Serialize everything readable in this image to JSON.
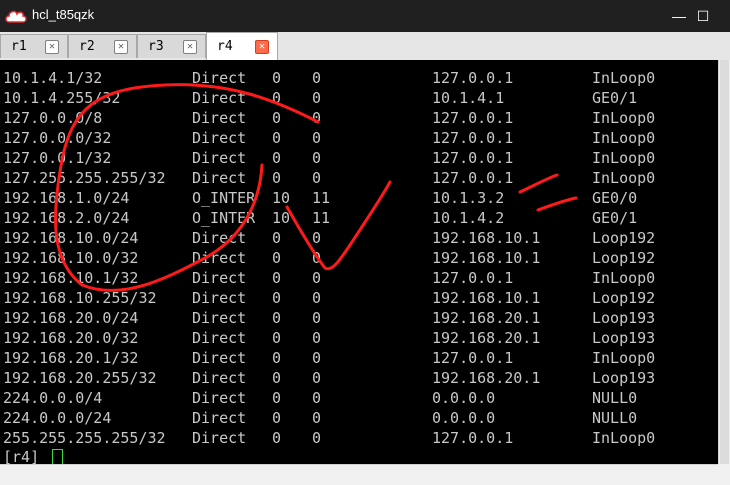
{
  "window": {
    "title": "hcl_t85qzk",
    "minimize_glyph": "—",
    "maximize_glyph": "☐"
  },
  "tabs": [
    {
      "label": "r1",
      "active": false
    },
    {
      "label": "r2",
      "active": false
    },
    {
      "label": "r3",
      "active": false
    },
    {
      "label": "r4",
      "active": true
    }
  ],
  "routes": [
    {
      "dest": "10.1.4.1/32",
      "proto": "Direct",
      "pre": "0",
      "cost": "0",
      "nexthop": "127.0.0.1",
      "iface": "InLoop0"
    },
    {
      "dest": "10.1.4.255/32",
      "proto": "Direct",
      "pre": "0",
      "cost": "0",
      "nexthop": "10.1.4.1",
      "iface": "GE0/1"
    },
    {
      "dest": "127.0.0.0/8",
      "proto": "Direct",
      "pre": "0",
      "cost": "0",
      "nexthop": "127.0.0.1",
      "iface": "InLoop0"
    },
    {
      "dest": "127.0.0.0/32",
      "proto": "Direct",
      "pre": "0",
      "cost": "0",
      "nexthop": "127.0.0.1",
      "iface": "InLoop0"
    },
    {
      "dest": "127.0.0.1/32",
      "proto": "Direct",
      "pre": "0",
      "cost": "0",
      "nexthop": "127.0.0.1",
      "iface": "InLoop0"
    },
    {
      "dest": "127.255.255.255/32",
      "proto": "Direct",
      "pre": "0",
      "cost": "0",
      "nexthop": "127.0.0.1",
      "iface": "InLoop0"
    },
    {
      "dest": "192.168.1.0/24",
      "proto": "O_INTER",
      "pre": "10",
      "cost": "11",
      "nexthop": "10.1.3.2",
      "iface": "GE0/0"
    },
    {
      "dest": "192.168.2.0/24",
      "proto": "O_INTER",
      "pre": "10",
      "cost": "11",
      "nexthop": "10.1.4.2",
      "iface": "GE0/1"
    },
    {
      "dest": "192.168.10.0/24",
      "proto": "Direct",
      "pre": "0",
      "cost": "0",
      "nexthop": "192.168.10.1",
      "iface": "Loop192"
    },
    {
      "dest": "192.168.10.0/32",
      "proto": "Direct",
      "pre": "0",
      "cost": "0",
      "nexthop": "192.168.10.1",
      "iface": "Loop192"
    },
    {
      "dest": "192.168.10.1/32",
      "proto": "Direct",
      "pre": "0",
      "cost": "0",
      "nexthop": "127.0.0.1",
      "iface": "InLoop0"
    },
    {
      "dest": "192.168.10.255/32",
      "proto": "Direct",
      "pre": "0",
      "cost": "0",
      "nexthop": "192.168.10.1",
      "iface": "Loop192"
    },
    {
      "dest": "192.168.20.0/24",
      "proto": "Direct",
      "pre": "0",
      "cost": "0",
      "nexthop": "192.168.20.1",
      "iface": "Loop193"
    },
    {
      "dest": "192.168.20.0/32",
      "proto": "Direct",
      "pre": "0",
      "cost": "0",
      "nexthop": "192.168.20.1",
      "iface": "Loop193"
    },
    {
      "dest": "192.168.20.1/32",
      "proto": "Direct",
      "pre": "0",
      "cost": "0",
      "nexthop": "127.0.0.1",
      "iface": "InLoop0"
    },
    {
      "dest": "192.168.20.255/32",
      "proto": "Direct",
      "pre": "0",
      "cost": "0",
      "nexthop": "192.168.20.1",
      "iface": "Loop193"
    },
    {
      "dest": "224.0.0.0/4",
      "proto": "Direct",
      "pre": "0",
      "cost": "0",
      "nexthop": "0.0.0.0",
      "iface": "NULL0"
    },
    {
      "dest": "224.0.0.0/24",
      "proto": "Direct",
      "pre": "0",
      "cost": "0",
      "nexthop": "0.0.0.0",
      "iface": "NULL0"
    },
    {
      "dest": "255.255.255.255/32",
      "proto": "Direct",
      "pre": "0",
      "cost": "0",
      "nexthop": "127.0.0.1",
      "iface": "InLoop0"
    }
  ],
  "prompt": "[r4]",
  "colors": {
    "terminal_bg": "#000000",
    "terminal_fg": "#c8c8c8",
    "annotation": "#ff1a1a",
    "cursor": "#3adb3a",
    "active_tab_close": "#ff6b4a"
  }
}
